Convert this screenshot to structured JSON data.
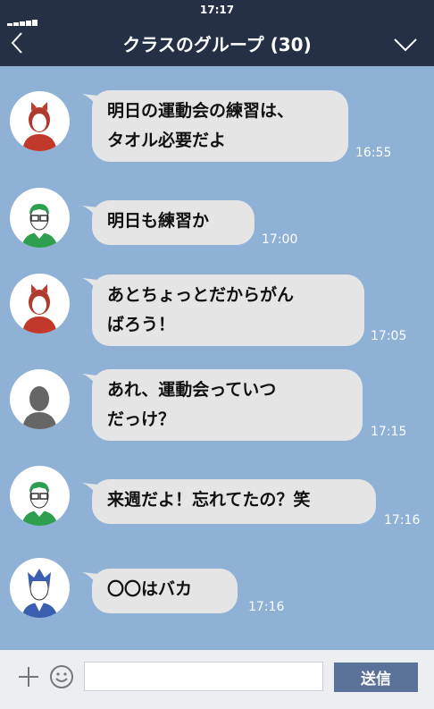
{
  "status_bar": {
    "time": "17:17"
  },
  "header": {
    "title": "クラスのグループ (30)",
    "back_icon": "chevron-left-icon",
    "menu_icon": "chevron-down-icon"
  },
  "messages": [
    {
      "avatar": "girl-avatar",
      "lines": [
        "明日の運動会の練習は、",
        "タオル必要だよ"
      ],
      "time": "16:55"
    },
    {
      "avatar": "boy-glasses-avatar",
      "lines": [
        "明日も練習か"
      ],
      "time": "17:00"
    },
    {
      "avatar": "girl-avatar",
      "lines": [
        "あとちょっとだからがん",
        "ばろう！"
      ],
      "time": "17:05"
    },
    {
      "avatar": "silhouette-avatar",
      "lines": [
        "あれ、運動会っていつ",
        "だっけ？"
      ],
      "time": "17:15"
    },
    {
      "avatar": "boy-glasses-avatar",
      "lines": [
        "来週だよ！忘れてたの？笑"
      ],
      "time": "17:16"
    },
    {
      "avatar": "spiky-hair-boy-avatar",
      "lines": [
        "〇〇はバカ"
      ],
      "time": "17:16"
    }
  ],
  "footer": {
    "plus_icon": "plus-icon",
    "emoji_icon": "smiley-icon",
    "input_placeholder": "",
    "send_label": "送信"
  },
  "colors": {
    "header_bg": "#253047",
    "chat_bg": "#8fb1d6",
    "bubble": "#e5e5e5",
    "send_button": "#5a7299"
  }
}
